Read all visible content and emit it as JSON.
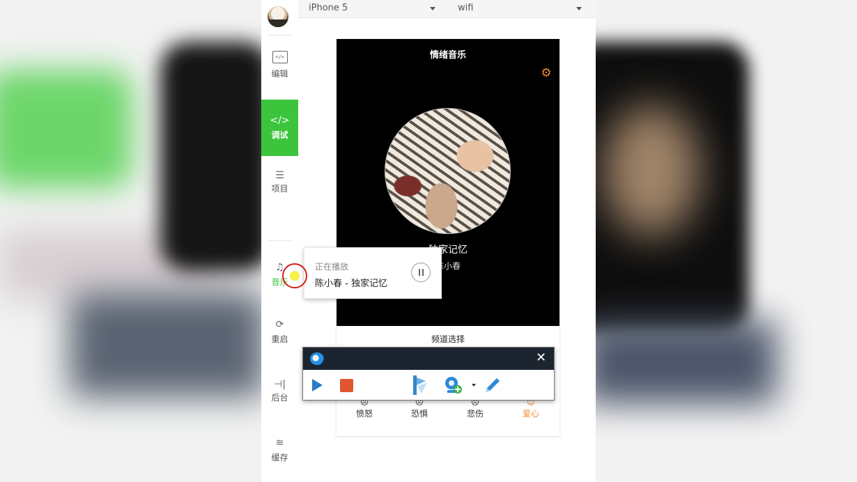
{
  "topbar": {
    "device": "iPhone 5",
    "network": "wifi"
  },
  "sidebar": {
    "items": [
      {
        "label": "编辑",
        "icon": "code-box-icon"
      },
      {
        "label": "调试",
        "icon": "code-icon",
        "active": true
      },
      {
        "label": "项目",
        "icon": "menu-icon"
      },
      {
        "label": "音乐",
        "icon": "music-note-icon"
      },
      {
        "label": "重启",
        "icon": "restart-icon"
      },
      {
        "label": "后台",
        "icon": "background-icon"
      },
      {
        "label": "缓存",
        "icon": "layers-icon"
      }
    ]
  },
  "phone": {
    "title": "情绪音乐",
    "song": "独家记忆",
    "artist": "陈小春",
    "channel_title": "频道选择",
    "moods": [
      {
        "label": "愤怒"
      },
      {
        "label": "恐惧"
      },
      {
        "label": "悲伤"
      },
      {
        "label": "爱心",
        "active": true
      }
    ],
    "accent": "#f08a2c"
  },
  "now_playing": {
    "status": "正在播放",
    "track": "陈小春 - 独家记忆"
  },
  "recorder": {
    "close": "✕"
  },
  "colors": {
    "active_green": "#3cc53c",
    "recorder_bar": "#1c2430"
  }
}
